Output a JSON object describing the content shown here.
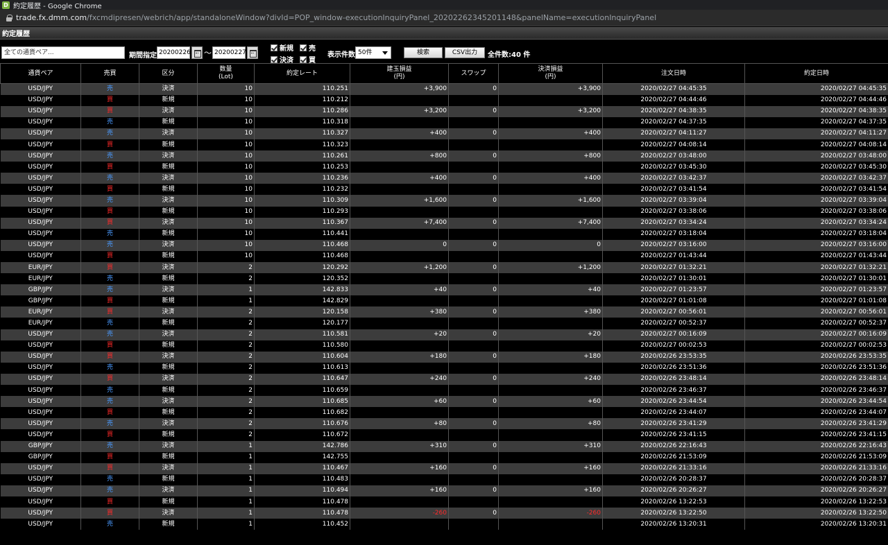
{
  "window": {
    "title": "約定履歴 - Google Chrome",
    "url_host": "trade.fx.dmm.com",
    "url_path": "/fxcmdipresen/webrich/app/standaloneWindow?divId=POP_window-executionInquiryPanel_20202262345201148&panelName=executionInquiryPanel"
  },
  "panel": {
    "title": "約定履歴"
  },
  "toolbar": {
    "pair_value": "全ての通貨ペア...",
    "period_label": "期間指定",
    "date_from": "20200226",
    "tilde": "〜",
    "date_to": "20200227",
    "chk_new": "新規",
    "chk_sell": "売",
    "chk_settle": "決済",
    "chk_buy": "買",
    "display_label": "表示件数",
    "display_value": "50件",
    "search_label": "検索",
    "csv_label": "CSV出力",
    "total_label": "全件数:40 件"
  },
  "columns": [
    "通貨ペア",
    "売買",
    "区分",
    "数量\n(Lot)",
    "約定レート",
    "建玉損益\n(円)",
    "スワップ",
    "決済損益\n(円)",
    "注文日時",
    "約定日時"
  ],
  "colors": {
    "sell": "#4a9aff",
    "buy": "#ff2a2a",
    "row_alt": "#3c3c3c"
  },
  "rows": [
    [
      "USD/JPY",
      "売",
      "決済",
      "10",
      "110.251",
      "+3,900",
      "0",
      "+3,900",
      "2020/02/27 04:45:35",
      "2020/02/27 04:45:35"
    ],
    [
      "USD/JPY",
      "買",
      "新規",
      "10",
      "110.212",
      "",
      "",
      "",
      "2020/02/27 04:44:46",
      "2020/02/27 04:44:46"
    ],
    [
      "USD/JPY",
      "買",
      "決済",
      "10",
      "110.286",
      "+3,200",
      "0",
      "+3,200",
      "2020/02/27 04:38:35",
      "2020/02/27 04:38:35"
    ],
    [
      "USD/JPY",
      "売",
      "新規",
      "10",
      "110.318",
      "",
      "",
      "",
      "2020/02/27 04:37:35",
      "2020/02/27 04:37:35"
    ],
    [
      "USD/JPY",
      "売",
      "決済",
      "10",
      "110.327",
      "+400",
      "0",
      "+400",
      "2020/02/27 04:11:27",
      "2020/02/27 04:11:27"
    ],
    [
      "USD/JPY",
      "買",
      "新規",
      "10",
      "110.323",
      "",
      "",
      "",
      "2020/02/27 04:08:14",
      "2020/02/27 04:08:14"
    ],
    [
      "USD/JPY",
      "売",
      "決済",
      "10",
      "110.261",
      "+800",
      "0",
      "+800",
      "2020/02/27 03:48:00",
      "2020/02/27 03:48:00"
    ],
    [
      "USD/JPY",
      "買",
      "新規",
      "10",
      "110.253",
      "",
      "",
      "",
      "2020/02/27 03:45:30",
      "2020/02/27 03:45:30"
    ],
    [
      "USD/JPY",
      "売",
      "決済",
      "10",
      "110.236",
      "+400",
      "0",
      "+400",
      "2020/02/27 03:42:37",
      "2020/02/27 03:42:37"
    ],
    [
      "USD/JPY",
      "買",
      "新規",
      "10",
      "110.232",
      "",
      "",
      "",
      "2020/02/27 03:41:54",
      "2020/02/27 03:41:54"
    ],
    [
      "USD/JPY",
      "売",
      "決済",
      "10",
      "110.309",
      "+1,600",
      "0",
      "+1,600",
      "2020/02/27 03:39:04",
      "2020/02/27 03:39:04"
    ],
    [
      "USD/JPY",
      "買",
      "新規",
      "10",
      "110.293",
      "",
      "",
      "",
      "2020/02/27 03:38:06",
      "2020/02/27 03:38:06"
    ],
    [
      "USD/JPY",
      "買",
      "決済",
      "10",
      "110.367",
      "+7,400",
      "0",
      "+7,400",
      "2020/02/27 03:34:24",
      "2020/02/27 03:34:24"
    ],
    [
      "USD/JPY",
      "売",
      "新規",
      "10",
      "110.441",
      "",
      "",
      "",
      "2020/02/27 03:18:04",
      "2020/02/27 03:18:04"
    ],
    [
      "USD/JPY",
      "売",
      "決済",
      "10",
      "110.468",
      "0",
      "0",
      "0",
      "2020/02/27 03:16:00",
      "2020/02/27 03:16:00"
    ],
    [
      "USD/JPY",
      "買",
      "新規",
      "10",
      "110.468",
      "",
      "",
      "",
      "2020/02/27 01:43:44",
      "2020/02/27 01:43:44"
    ],
    [
      "EUR/JPY",
      "買",
      "決済",
      "2",
      "120.292",
      "+1,200",
      "0",
      "+1,200",
      "2020/02/27 01:32:21",
      "2020/02/27 01:32:21"
    ],
    [
      "EUR/JPY",
      "売",
      "新規",
      "2",
      "120.352",
      "",
      "",
      "",
      "2020/02/27 01:30:01",
      "2020/02/27 01:30:01"
    ],
    [
      "GBP/JPY",
      "売",
      "決済",
      "1",
      "142.833",
      "+40",
      "0",
      "+40",
      "2020/02/27 01:23:57",
      "2020/02/27 01:23:57"
    ],
    [
      "GBP/JPY",
      "買",
      "新規",
      "1",
      "142.829",
      "",
      "",
      "",
      "2020/02/27 01:01:08",
      "2020/02/27 01:01:08"
    ],
    [
      "EUR/JPY",
      "買",
      "決済",
      "2",
      "120.158",
      "+380",
      "0",
      "+380",
      "2020/02/27 00:56:01",
      "2020/02/27 00:56:01"
    ],
    [
      "EUR/JPY",
      "売",
      "新規",
      "2",
      "120.177",
      "",
      "",
      "",
      "2020/02/27 00:52:37",
      "2020/02/27 00:52:37"
    ],
    [
      "USD/JPY",
      "売",
      "決済",
      "2",
      "110.581",
      "+20",
      "0",
      "+20",
      "2020/02/27 00:16:09",
      "2020/02/27 00:16:09"
    ],
    [
      "USD/JPY",
      "買",
      "新規",
      "2",
      "110.580",
      "",
      "",
      "",
      "2020/02/27 00:02:53",
      "2020/02/27 00:02:53"
    ],
    [
      "USD/JPY",
      "買",
      "決済",
      "2",
      "110.604",
      "+180",
      "0",
      "+180",
      "2020/02/26 23:53:35",
      "2020/02/26 23:53:35"
    ],
    [
      "USD/JPY",
      "売",
      "新規",
      "2",
      "110.613",
      "",
      "",
      "",
      "2020/02/26 23:51:36",
      "2020/02/26 23:51:36"
    ],
    [
      "USD/JPY",
      "買",
      "決済",
      "2",
      "110.647",
      "+240",
      "0",
      "+240",
      "2020/02/26 23:48:14",
      "2020/02/26 23:48:14"
    ],
    [
      "USD/JPY",
      "売",
      "新規",
      "2",
      "110.659",
      "",
      "",
      "",
      "2020/02/26 23:46:37",
      "2020/02/26 23:46:37"
    ],
    [
      "USD/JPY",
      "売",
      "決済",
      "2",
      "110.685",
      "+60",
      "0",
      "+60",
      "2020/02/26 23:44:54",
      "2020/02/26 23:44:54"
    ],
    [
      "USD/JPY",
      "買",
      "新規",
      "2",
      "110.682",
      "",
      "",
      "",
      "2020/02/26 23:44:07",
      "2020/02/26 23:44:07"
    ],
    [
      "USD/JPY",
      "売",
      "決済",
      "2",
      "110.676",
      "+80",
      "0",
      "+80",
      "2020/02/26 23:41:29",
      "2020/02/26 23:41:29"
    ],
    [
      "USD/JPY",
      "買",
      "新規",
      "2",
      "110.672",
      "",
      "",
      "",
      "2020/02/26 23:41:15",
      "2020/02/26 23:41:15"
    ],
    [
      "GBP/JPY",
      "売",
      "決済",
      "1",
      "142.786",
      "+310",
      "0",
      "+310",
      "2020/02/26 22:16:43",
      "2020/02/26 22:16:43"
    ],
    [
      "GBP/JPY",
      "買",
      "新規",
      "1",
      "142.755",
      "",
      "",
      "",
      "2020/02/26 21:53:09",
      "2020/02/26 21:53:09"
    ],
    [
      "USD/JPY",
      "買",
      "決済",
      "1",
      "110.467",
      "+160",
      "0",
      "+160",
      "2020/02/26 21:33:16",
      "2020/02/26 21:33:16"
    ],
    [
      "USD/JPY",
      "売",
      "新規",
      "1",
      "110.483",
      "",
      "",
      "",
      "2020/02/26 20:28:37",
      "2020/02/26 20:28:37"
    ],
    [
      "USD/JPY",
      "売",
      "決済",
      "1",
      "110.494",
      "+160",
      "0",
      "+160",
      "2020/02/26 20:26:27",
      "2020/02/26 20:26:27"
    ],
    [
      "USD/JPY",
      "買",
      "新規",
      "1",
      "110.478",
      "",
      "",
      "",
      "2020/02/26 13:22:53",
      "2020/02/26 13:22:53"
    ],
    [
      "USD/JPY",
      "買",
      "決済",
      "1",
      "110.478",
      "-260",
      "0",
      "-260",
      "2020/02/26 13:22:50",
      "2020/02/26 13:22:50"
    ],
    [
      "USD/JPY",
      "売",
      "新規",
      "1",
      "110.452",
      "",
      "",
      "",
      "2020/02/26 13:20:31",
      "2020/02/26 13:20:31"
    ]
  ]
}
